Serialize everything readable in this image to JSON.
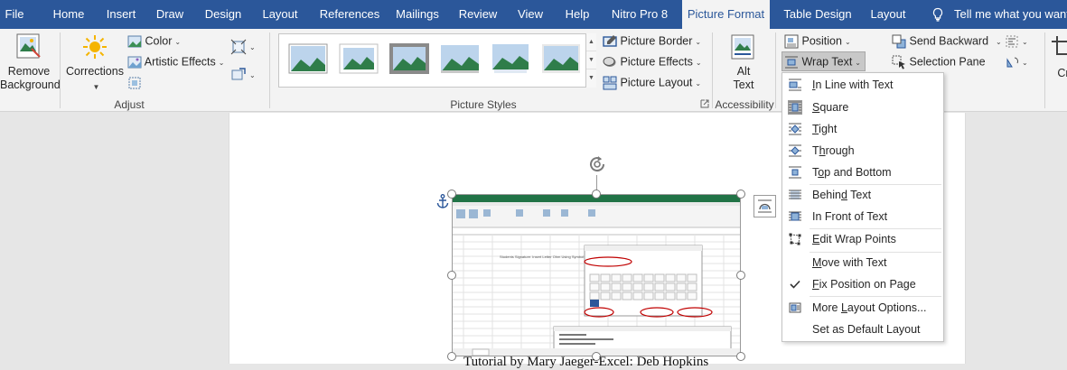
{
  "tabs": [
    {
      "label": "File",
      "active": false
    },
    {
      "label": "Home",
      "active": false
    },
    {
      "label": "Insert",
      "active": false
    },
    {
      "label": "Draw",
      "active": false
    },
    {
      "label": "Design",
      "active": false
    },
    {
      "label": "Layout",
      "active": false
    },
    {
      "label": "References",
      "active": false
    },
    {
      "label": "Mailings",
      "active": false
    },
    {
      "label": "Review",
      "active": false
    },
    {
      "label": "View",
      "active": false
    },
    {
      "label": "Help",
      "active": false
    },
    {
      "label": "Nitro Pro 8",
      "active": false
    },
    {
      "label": "Picture Format",
      "active": true
    },
    {
      "label": "Table Design",
      "active": false
    },
    {
      "label": "Layout",
      "active": false
    }
  ],
  "tell_me": "Tell me what you want t",
  "ribbon": {
    "adjust": {
      "remove_background": [
        "Remove",
        "Background"
      ],
      "corrections": "Corrections",
      "color": "Color",
      "artistic_effects": "Artistic Effects",
      "group_label": "Adjust"
    },
    "picture_styles": {
      "picture_border": "Picture Border",
      "picture_effects": "Picture Effects",
      "picture_layout": "Picture Layout",
      "group_label": "Picture Styles"
    },
    "accessibility": {
      "alt_text": [
        "Alt",
        "Text"
      ],
      "group_label": "Accessibility"
    },
    "arrange": {
      "position": "Position",
      "wrap_text": "Wrap Text",
      "send_backward": "Send Backward",
      "selection_pane": "Selection Pane",
      "crop_partial": "Cr"
    }
  },
  "wrap_menu": {
    "items": [
      {
        "label": "In Line with Text",
        "mnemonic": "I"
      },
      {
        "label": "Square",
        "mnemonic": "S",
        "selected": true
      },
      {
        "label": "Tight",
        "mnemonic": "T"
      },
      {
        "label": "Through",
        "mnemonic": "h"
      },
      {
        "label": "Top and Bottom",
        "mnemonic": "o"
      },
      {
        "label": "Behind Text",
        "mnemonic": "d"
      },
      {
        "label": "In Front of Text",
        "mnemonic": "N"
      },
      {
        "label": "Edit Wrap Points",
        "mnemonic": "E"
      },
      {
        "label": "Move with Text",
        "mnemonic": "M"
      },
      {
        "label": "Fix Position on Page",
        "mnemonic": "F",
        "checked": true
      },
      {
        "label": "More Layout Options...",
        "mnemonic": "L"
      },
      {
        "label": "Set as Default Layout",
        "mnemonic": "A"
      }
    ]
  },
  "document": {
    "caption": "Tutorial by Mary Jaeger-Excel: Deb Hopkins"
  },
  "colors": {
    "tabbar": "#2b579a",
    "ribbon": "#f3f3f3",
    "document_bg": "#e6e6e6",
    "excel_green": "#217346",
    "annotation_red": "#c00000"
  }
}
